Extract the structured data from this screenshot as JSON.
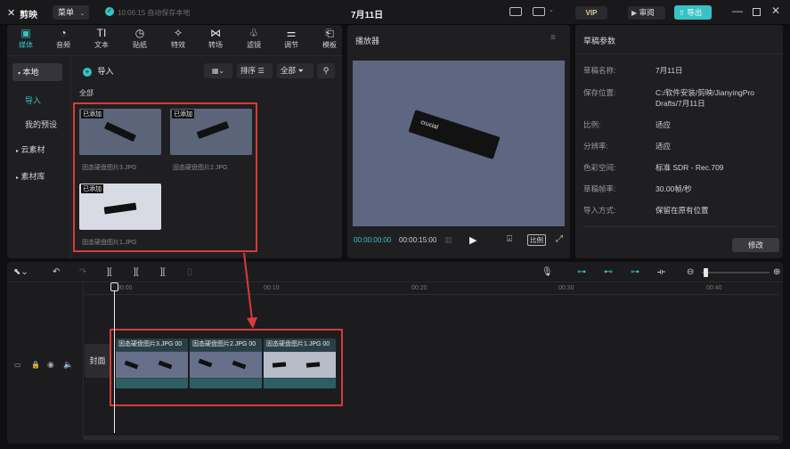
{
  "titlebar": {
    "app_name": "剪映",
    "menu_label": "菜单",
    "autosave": "10:06:15 自动保存本地",
    "project_title": "7月11日",
    "review_label": "审阅",
    "export_label": "导出",
    "vip_label": "VIP"
  },
  "toolbar": {
    "tabs": [
      {
        "label": "媒体",
        "icon": "media-icon"
      },
      {
        "label": "音频",
        "icon": "audio-icon"
      },
      {
        "label": "文本",
        "icon": "text-icon"
      },
      {
        "label": "贴纸",
        "icon": "sticker-icon"
      },
      {
        "label": "特效",
        "icon": "effects-icon"
      },
      {
        "label": "转场",
        "icon": "transition-icon"
      },
      {
        "label": "滤镜",
        "icon": "filter-icon"
      },
      {
        "label": "调节",
        "icon": "adjust-icon"
      },
      {
        "label": "模板",
        "icon": "template-icon"
      }
    ]
  },
  "sidebar": {
    "local": "本地",
    "import": "导入",
    "presets": "我的预设",
    "cloud": "云素材",
    "library": "素材库"
  },
  "media": {
    "import_button": "导入",
    "sort_label": "排序",
    "filter_label": "全部",
    "all_label": "全部",
    "added_badge": "已添加",
    "items": [
      "固态硬盘图片3.JPG",
      "固态硬盘图片2.JPG",
      "固态硬盘图片1.JPG"
    ]
  },
  "player": {
    "title": "播放器",
    "current_time": "00:00:00:00",
    "total_time": "00:00:15:00",
    "ratio_label": "比例"
  },
  "draft": {
    "title": "草稿参数",
    "rows": [
      {
        "label": "草稿名称:",
        "value": "7月11日"
      },
      {
        "label": "保存位置:",
        "value": "C:/软件安装/剪映/JianyingPro Drafts/7月11日"
      },
      {
        "label": "比例:",
        "value": "适应"
      },
      {
        "label": "分辨率:",
        "value": "适应"
      },
      {
        "label": "色彩空间:",
        "value": "标准 SDR - Rec.709"
      },
      {
        "label": "草稿帧率:",
        "value": "30.00帧/秒"
      },
      {
        "label": "导入方式:",
        "value": "保留在原有位置"
      }
    ],
    "edit_button": "修改"
  },
  "timeline": {
    "ruler": [
      "00:00",
      "00:10",
      "00:20",
      "00:30",
      "00:40"
    ],
    "cover_label": "封面",
    "clips": [
      {
        "name": "固态硬盘图片3.JPG",
        "dur": "00"
      },
      {
        "name": "固态硬盘图片2.JPG",
        "dur": "00"
      },
      {
        "name": "固态硬盘图片1.JPG",
        "dur": "00"
      }
    ]
  },
  "colors": {
    "accent": "#37c2c5",
    "highlight": "#d93a3a"
  }
}
